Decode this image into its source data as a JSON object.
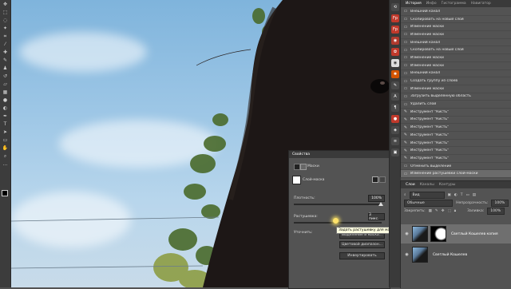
{
  "history": {
    "tabs": [
      "История",
      "Инфо",
      "Гистограмма",
      "Навигатор"
    ],
    "items": [
      {
        "label": "Внешний канал",
        "icon": "layer-icon"
      },
      {
        "label": "Скопировать на новый слой",
        "icon": "layer-icon"
      },
      {
        "label": "Изменение маски",
        "icon": "layer-icon"
      },
      {
        "label": "Изменение маски",
        "icon": "layer-icon"
      },
      {
        "label": "Внешний канал",
        "icon": "layer-icon"
      },
      {
        "label": "Скопировать на новый слой",
        "icon": "layer-icon"
      },
      {
        "label": "Изменение маски",
        "icon": "layer-icon"
      },
      {
        "label": "Изменение маски",
        "icon": "layer-icon"
      },
      {
        "label": "Внешний канал",
        "icon": "layer-icon"
      },
      {
        "label": "Создать группу из слоев",
        "icon": "layer-icon"
      },
      {
        "label": "Изменение маски",
        "icon": "layer-icon"
      },
      {
        "label": "Загрузить выделенную область",
        "icon": "layer-icon"
      },
      {
        "label": "Удалить слой",
        "icon": "layer-icon"
      },
      {
        "label": "Инструмент \"Кисть\"",
        "icon": "brush-icon"
      },
      {
        "label": "Инструмент \"Кисть\"",
        "icon": "brush-icon"
      },
      {
        "label": "Инструмент \"Кисть\"",
        "icon": "brush-icon"
      },
      {
        "label": "Инструмент \"Кисть\"",
        "icon": "brush-icon"
      },
      {
        "label": "Инструмент \"Кисть\"",
        "icon": "brush-icon"
      },
      {
        "label": "Инструмент \"Кисть\"",
        "icon": "brush-icon"
      },
      {
        "label": "Инструмент \"Кисть\"",
        "icon": "brush-icon"
      },
      {
        "label": "Отменить выделение",
        "icon": "layer-icon"
      },
      {
        "label": "Изменение растушевки слой-маски",
        "icon": "layer-icon"
      }
    ]
  },
  "layers": {
    "tabs": [
      "Слои",
      "Каналы",
      "Контуры"
    ],
    "filter_kind": "Вид",
    "blend_mode": "Обычные",
    "opacity_label": "Непрозрачность:",
    "opacity_value": "100%",
    "lock_label": "Закрепить:",
    "fill_label": "Заливка:",
    "fill_value": "100%",
    "items": [
      {
        "name": "Светлый Кошелев копия"
      },
      {
        "name": "Светлый Кошелев"
      }
    ]
  },
  "properties": {
    "title": "Свойства",
    "section": "Маски",
    "mask_type": "Слой-маска",
    "density_label": "Плотность:",
    "density_value": "100%",
    "feather_label": "Растушевка:",
    "feather_value": "3 пикс.",
    "refine_label": "Уточнить:",
    "tooltip": "Задать растушевку для маски",
    "btn_edge": "Выделение и маска...",
    "btn_color": "Цветовой диапазон...",
    "btn_invert": "Инвертировать"
  },
  "colors": {
    "accent_red": "#c0392b",
    "selection": "#6f6f6f"
  }
}
